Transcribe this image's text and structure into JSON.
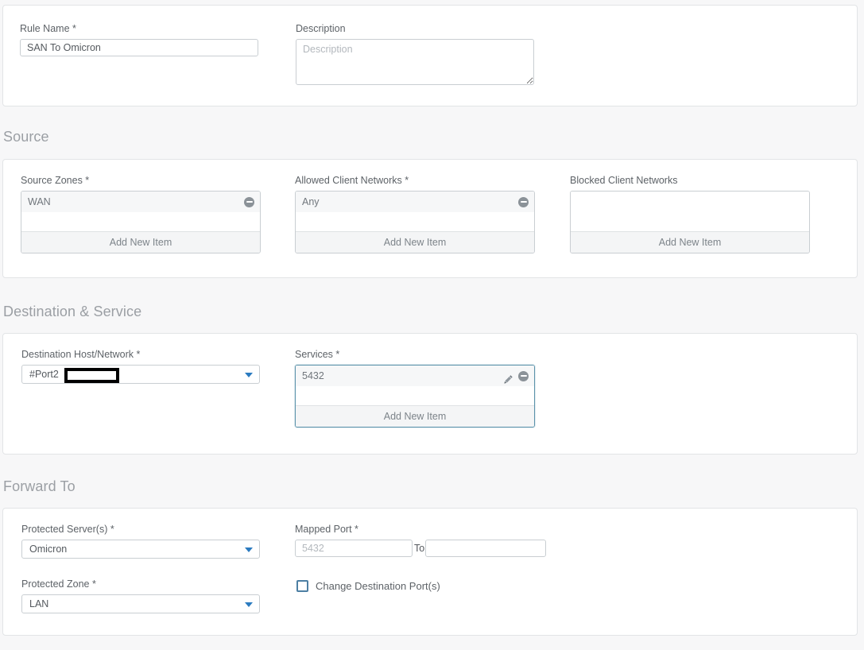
{
  "general": {
    "rule_name": {
      "label": "Rule Name *",
      "value": "SAN To Omicron",
      "name": "rule-name-input"
    },
    "description": {
      "label": "Description",
      "value": "",
      "placeholder": "Description",
      "name": "description-textarea"
    }
  },
  "source": {
    "heading": "Source",
    "source_zones": {
      "label": "Source Zones *",
      "items": [
        "WAN"
      ],
      "add_label": "Add New Item"
    },
    "allowed_client_networks": {
      "label": "Allowed Client Networks *",
      "items": [
        "Any"
      ],
      "add_label": "Add New Item"
    },
    "blocked_client_networks": {
      "label": "Blocked Client Networks",
      "items": [],
      "add_label": "Add New Item"
    }
  },
  "destination": {
    "heading": "Destination & Service",
    "host_network": {
      "label": "Destination Host/Network *",
      "value": "#Port2",
      "redacted": true
    },
    "services": {
      "label": "Services *",
      "items": [
        "5432"
      ],
      "add_label": "Add New Item",
      "focused": true
    }
  },
  "forward_to": {
    "heading": "Forward To",
    "protected_servers": {
      "label": "Protected Server(s) *",
      "value": "Omicron"
    },
    "protected_zone": {
      "label": "Protected Zone *",
      "value": "LAN"
    },
    "mapped_port": {
      "label": "Mapped Port *",
      "from_value": "",
      "from_placeholder": "5432",
      "separator": "To",
      "to_value": "",
      "to_placeholder": ""
    },
    "change_destination_ports": {
      "label": "Change Destination Port(s)",
      "checked": false
    }
  },
  "colors": {
    "accent_blue": "#2b7bc0",
    "focus_border": "#5c93ab",
    "checkbox_border": "#4d7fa3",
    "heading_gray": "#9b9fa4",
    "card_border": "#e2e4e6",
    "page_bg": "#f7f7f8"
  }
}
